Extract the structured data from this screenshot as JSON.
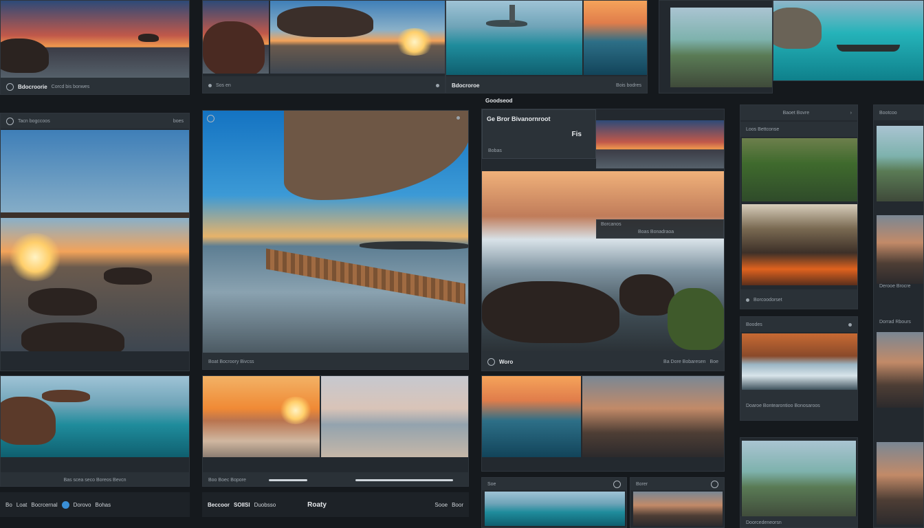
{
  "panels": {
    "top_left": {
      "caption": "Bdocroorie",
      "meta": "Corcd bis bonwes"
    },
    "top_mid": {
      "caption": "Sos en"
    },
    "top_mid_right": {
      "caption": "Bdocroroe",
      "meta": "Bois bodres"
    },
    "left_main": {
      "title": "Tacn bogccoos",
      "meta": "boes"
    },
    "center_main": {
      "footer": "Boat Bocroory Bivcss"
    },
    "right_main": {
      "header": "Goodseod",
      "title": "Ge Bror Bivanornroot",
      "sub": "Fis",
      "badge": "Bobas",
      "overlay": "Borcanos",
      "overlay_sub": "Boas Bonadraoa",
      "footer_left": "Woro",
      "footer_mid": "Ba Dore Bobaresen",
      "footer_right": "Boe"
    },
    "col4_header": {
      "title": "Baoet Bovre",
      "sub": "Loos Bettconse"
    },
    "col4_item1": {
      "caption": "Borcoodorset"
    },
    "col4_item2": {
      "title": "Boodes",
      "caption": "Doaroe Bontearontioo Bonosaroos"
    },
    "col4_bottom": {
      "caption": "Doorcedeneorsn"
    },
    "col5": {
      "title": "Bootcoo",
      "item": "Derooe Brocre",
      "item2": "Dorrad Rbours"
    },
    "bottom_left_img": {
      "caption": "Bas scea seco Boreos Bevcn"
    },
    "bottom_mid": {
      "caption": "Boo Boec Bopore"
    },
    "bottom_right_small": {
      "title": "Soe",
      "title2": "Borer"
    }
  },
  "bottom_bar": {
    "left_items": [
      "Bo",
      "Loat",
      "Bocrcernal",
      "Dorovo",
      "Bohas"
    ],
    "mid_items": [
      "Beccoor",
      "SOIISI",
      "Duobsso"
    ],
    "right_items": [
      "Roaty",
      "Sooe",
      "Boor"
    ]
  },
  "icons": [
    "settings-icon",
    "camera-icon",
    "globe-icon",
    "share-icon",
    "chevron-icon",
    "close-icon"
  ]
}
